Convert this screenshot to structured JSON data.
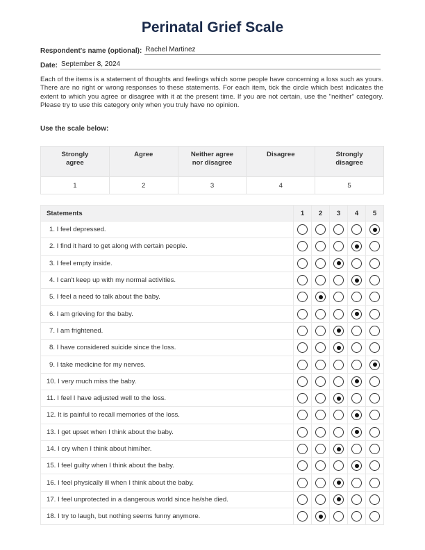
{
  "title": "Perinatal Grief Scale",
  "respondent": {
    "label": "Respondent's name (optional):",
    "value": "Rachel Martinez"
  },
  "date": {
    "label": "Date:",
    "value": "September 8, 2024"
  },
  "intro": "Each of the items is a statement of thoughts and feelings which some people have concerning a loss such as yours. There are no right or wrong responses to these statements. For each item, tick the circle which best indicates the extent to which you agree or disagree with it at the present time. If you are not certain, use the \"neither\" category. Please try to use this category only when you truly have no opinion.",
  "scale_label": "Use the scale below:",
  "scale": [
    {
      "label": "Strongly agree",
      "value": "1"
    },
    {
      "label": "Agree",
      "value": "2"
    },
    {
      "label": "Neither agree nor disagree",
      "value": "3"
    },
    {
      "label": "Disagree",
      "value": "4"
    },
    {
      "label": "Strongly disagree",
      "value": "5"
    }
  ],
  "statements_header": "Statements",
  "columns": [
    "1",
    "2",
    "3",
    "4",
    "5"
  ],
  "items": [
    {
      "text": "1. I feel depressed.",
      "selected": 5
    },
    {
      "text": "2. I find it hard to get along with certain people.",
      "selected": 4
    },
    {
      "text": "3. I feel empty inside.",
      "selected": 3
    },
    {
      "text": "4. I can't keep up with my normal activities.",
      "selected": 4
    },
    {
      "text": "5. I feel a need to talk about the baby.",
      "selected": 2
    },
    {
      "text": "6. I am grieving for the baby.",
      "selected": 4
    },
    {
      "text": "7. I am frightened.",
      "selected": 3
    },
    {
      "text": "8. I have considered suicide since the loss.",
      "selected": 3
    },
    {
      "text": "9. I take medicine for my nerves.",
      "selected": 5
    },
    {
      "text": "10. I very much miss the baby.",
      "selected": 4
    },
    {
      "text": "11. I feel I have adjusted well to the loss.",
      "selected": 3
    },
    {
      "text": "12. It is painful to recall memories of the loss.",
      "selected": 4
    },
    {
      "text": "13. I get upset when I think about the baby.",
      "selected": 4
    },
    {
      "text": "14. I cry when I think about him/her.",
      "selected": 3
    },
    {
      "text": "15. I feel guilty when I think about the baby.",
      "selected": 4
    },
    {
      "text": "16. I feel physically ill when I think about the baby.",
      "selected": 3
    },
    {
      "text": "17. I feel unprotected in a dangerous world since he/she died.",
      "selected": 3
    },
    {
      "text": "18. I try to laugh, but nothing seems funny anymore.",
      "selected": 2
    }
  ]
}
